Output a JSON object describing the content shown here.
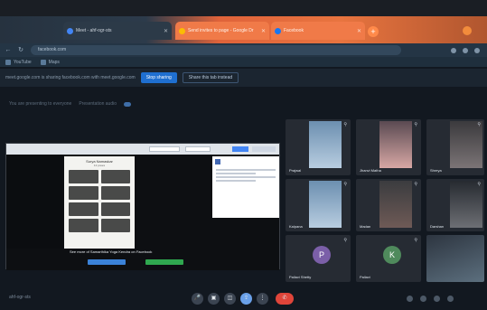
{
  "browser": {
    "tabs": [
      {
        "label": "Meet - ahf-ogr-sts",
        "favicon_color": "#4285f4"
      },
      {
        "label": "Send invites to page - Google Dr",
        "favicon_color": "#fbbc04"
      },
      {
        "label": "Facebook",
        "favicon_color": "#1877f2"
      }
    ],
    "new_tab_label": "+",
    "url": "facebook.com",
    "bookmarks": [
      "YouTube",
      "Maps"
    ]
  },
  "sharebar": {
    "text": "meet.google.com is sharing facebook.com with meet.google.com",
    "stop_label": "Stop sharing",
    "tab_label": "Share this tab instead"
  },
  "meeting": {
    "status": "You are presenting to everyone",
    "presentation_label": "Presentation audio",
    "code": "ahf-ogr-sts"
  },
  "shared_screen": {
    "poster_title": "Surya Namaskar",
    "poster_subtitle": "12 poses",
    "promo_text": "See more of Samarthika Yoga Kendra on Facebook",
    "promo_btn_a": "Log In",
    "promo_btn_b": "Create New Account"
  },
  "participants": [
    {
      "name": "Prajwal",
      "video": "blue"
    },
    {
      "name": "Jhanvi Matha",
      "video": "pink"
    },
    {
      "name": "Shreya",
      "video": "dark"
    },
    {
      "name": "Kalpana",
      "video": "blue"
    },
    {
      "name": "Madan",
      "video": "room"
    },
    {
      "name": "Darshan",
      "video": "room2"
    },
    {
      "name": "Pallavi Shetty",
      "avatar": "P"
    },
    {
      "name": "Pallavi",
      "avatar": "K"
    }
  ],
  "colors": {
    "tab_active": "#f07a48",
    "stop_button": "#1f6fd0",
    "end_call": "#e0453a"
  }
}
